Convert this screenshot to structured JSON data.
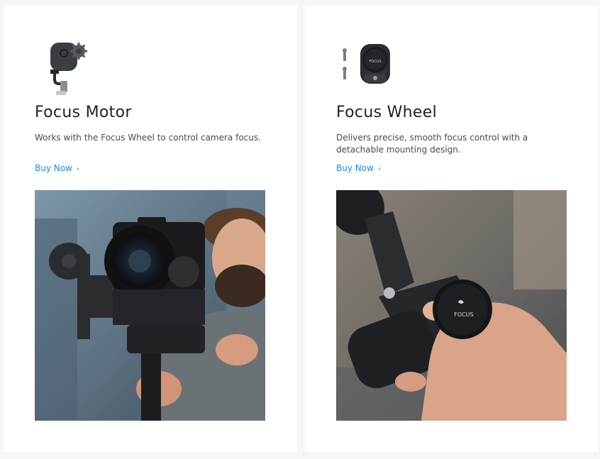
{
  "products": [
    {
      "title": "Focus Motor",
      "description": "Works with the Focus Wheel to control camera focus.",
      "cta": "Buy Now",
      "cta_icon": "chevron-right-icon",
      "icon": "focus-motor-icon",
      "photo": "focus-motor-photo"
    },
    {
      "title": "Focus Wheel",
      "description": "Delivers precise, smooth focus control with a detachable mounting design.",
      "cta": "Buy Now",
      "cta_icon": "chevron-right-icon",
      "icon": "focus-wheel-icon",
      "photo": "focus-wheel-photo",
      "icon_label": "FOCUS",
      "photo_label": "FOCUS"
    }
  ],
  "colors": {
    "page_bg": "#f4f5f7",
    "card_bg": "#ffffff",
    "link": "#1e88e5",
    "title": "#222222",
    "body_text": "#4a4a4a"
  }
}
